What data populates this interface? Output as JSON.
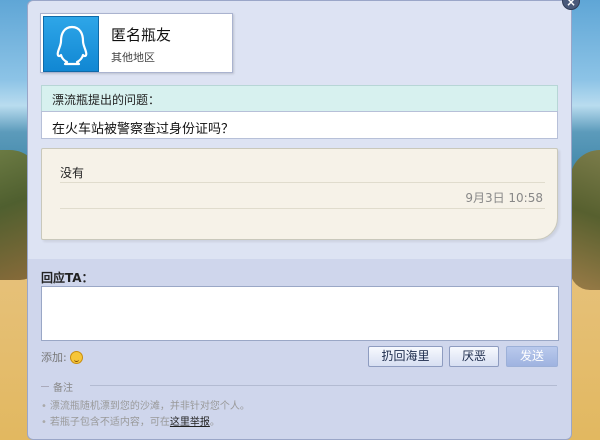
{
  "profile": {
    "nickname": "匿名瓶友",
    "region": "其他地区"
  },
  "question": {
    "header": "漂流瓶提出的问题：",
    "text": "在火车站被警察查过身份证吗？"
  },
  "answer": {
    "text": "没有",
    "time": "9月3日 10:58"
  },
  "reply": {
    "label": "回应TA：",
    "value": "",
    "placeholder": ""
  },
  "toolbar": {
    "add_label": "添加:",
    "return_label": "扔回海里",
    "dislike_label": "厌恶",
    "send_label": "发送"
  },
  "notes": {
    "title": "备注",
    "items": [
      "漂流瓶随机漂到您的沙滩，并非针对您个人。",
      "若瓶子包含不适内容，可在"
    ],
    "report_link": "这里举报",
    "item2_suffix": "。"
  },
  "colors": {
    "panel": "#cfd6ec",
    "question_header": "#d7f1ef",
    "bubble": "#f6f2e8",
    "avatar": "#1e9be0"
  },
  "icons": {
    "avatar": "qq-penguin-icon",
    "close": "close-icon",
    "emoji": "smiley-icon"
  }
}
